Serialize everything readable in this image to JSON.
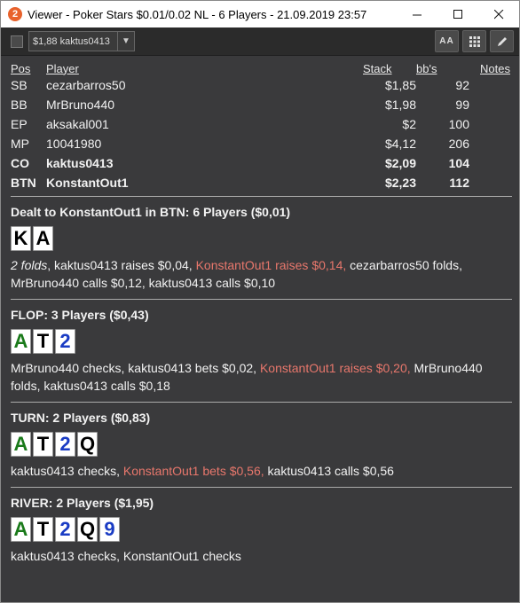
{
  "window": {
    "title": "Viewer - Poker Stars $0.01/0.02 NL - 6 Players - 21.09.2019 23:57",
    "app_icon": "2"
  },
  "toolbar": {
    "select_value": "$1,88 kaktus0413",
    "size_label": "AA"
  },
  "table_headers": {
    "pos": "Pos",
    "player": "Player",
    "stack": "Stack",
    "bbs": "bb's",
    "notes": "Notes"
  },
  "players": [
    {
      "pos": "SB",
      "name": "cezarbarros50",
      "stack": "$1,85",
      "bbs": "92",
      "hero": false
    },
    {
      "pos": "BB",
      "name": "MrBruno440",
      "stack": "$1,98",
      "bbs": "99",
      "hero": false
    },
    {
      "pos": "EP",
      "name": "aksakal001",
      "stack": "$2",
      "bbs": "100",
      "hero": false
    },
    {
      "pos": "MP",
      "name": "10041980",
      "stack": "$4,12",
      "bbs": "206",
      "hero": false
    },
    {
      "pos": "CO",
      "name": "kaktus0413",
      "stack": "$2,09",
      "bbs": "104",
      "hero": true
    },
    {
      "pos": "BTN",
      "name": "KonstantOut1",
      "stack": "$2,23",
      "bbs": "112",
      "hero": true
    }
  ],
  "streets": [
    {
      "title": "Dealt to KonstantOut1 in BTN: 6 Players ($0,01)",
      "cards": [
        {
          "rank": "K",
          "suit": "s"
        },
        {
          "rank": "A",
          "suit": "s"
        }
      ],
      "actions": [
        {
          "text": "2 folds",
          "style": "italic"
        },
        {
          "text": ", kaktus0413 raises $0,04, ",
          "style": "normal"
        },
        {
          "text": "KonstantOut1 raises $0,14,",
          "style": "hl"
        },
        {
          "text": " cezarbarros50 folds, MrBruno440 calls $0,12, kaktus0413 calls $0,10",
          "style": "normal"
        }
      ]
    },
    {
      "title": "FLOP: 3 Players ($0,43)",
      "cards": [
        {
          "rank": "A",
          "suit": "c"
        },
        {
          "rank": "T",
          "suit": "s"
        },
        {
          "rank": "2",
          "suit": "d"
        }
      ],
      "actions": [
        {
          "text": "MrBruno440 checks, kaktus0413 bets $0,02, ",
          "style": "normal"
        },
        {
          "text": "KonstantOut1 raises $0,20,",
          "style": "hl"
        },
        {
          "text": " MrBruno440 folds, kaktus0413 calls $0,18",
          "style": "normal"
        }
      ]
    },
    {
      "title": "TURN: 2 Players ($0,83)",
      "cards": [
        {
          "rank": "A",
          "suit": "c"
        },
        {
          "rank": "T",
          "suit": "s"
        },
        {
          "rank": "2",
          "suit": "d"
        },
        {
          "rank": "Q",
          "suit": "s"
        }
      ],
      "actions": [
        {
          "text": "kaktus0413 checks, ",
          "style": "normal"
        },
        {
          "text": "KonstantOut1 bets $0,56,",
          "style": "hl"
        },
        {
          "text": " kaktus0413 calls $0,56",
          "style": "normal"
        }
      ]
    },
    {
      "title": "RIVER: 2 Players ($1,95)",
      "cards": [
        {
          "rank": "A",
          "suit": "c"
        },
        {
          "rank": "T",
          "suit": "s"
        },
        {
          "rank": "2",
          "suit": "d"
        },
        {
          "rank": "Q",
          "suit": "s"
        },
        {
          "rank": "9",
          "suit": "d"
        }
      ],
      "actions": [
        {
          "text": "kaktus0413 checks, KonstantOut1 checks",
          "style": "normal"
        }
      ]
    }
  ],
  "colors": {
    "highlight": "#e8776c",
    "spade": "#000000",
    "club": "#1a7a1a",
    "diamond": "#1a3cc4"
  }
}
